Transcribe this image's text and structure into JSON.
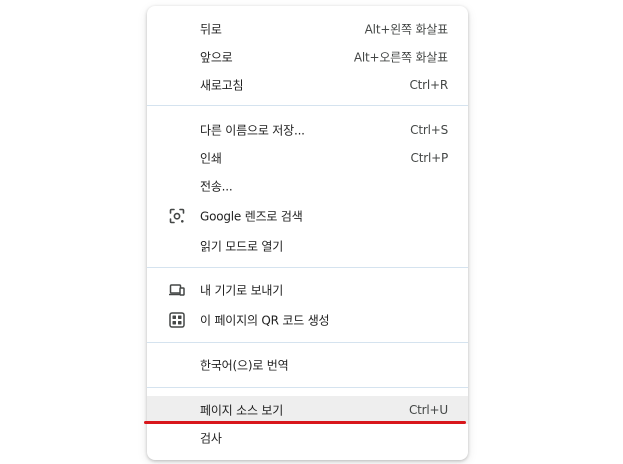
{
  "menu": {
    "items": [
      {
        "label": "뒤로",
        "shortcut": "Alt+왼쪽 화살표"
      },
      {
        "label": "앞으로",
        "shortcut": "Alt+오른쪽 화살표"
      },
      {
        "label": "새로고침",
        "shortcut": "Ctrl+R"
      },
      {
        "label": "다른 이름으로 저장...",
        "shortcut": "Ctrl+S"
      },
      {
        "label": "인쇄",
        "shortcut": "Ctrl+P"
      },
      {
        "label": "전송..."
      },
      {
        "label": "Google 렌즈로 검색",
        "icon": "google-lens-icon"
      },
      {
        "label": "읽기 모드로 열기"
      },
      {
        "label": "내 기기로 보내기",
        "icon": "devices-icon"
      },
      {
        "label": "이 페이지의 QR 코드 생성",
        "icon": "qr-code-icon"
      },
      {
        "label": "한국어(으)로 번역"
      },
      {
        "label": "페이지 소스 보기",
        "shortcut": "Ctrl+U"
      },
      {
        "label": "검사"
      }
    ]
  },
  "colors": {
    "highlight": "#eeeeee",
    "separator": "#d5e3ef",
    "annotation_underline": "#d8161b"
  }
}
